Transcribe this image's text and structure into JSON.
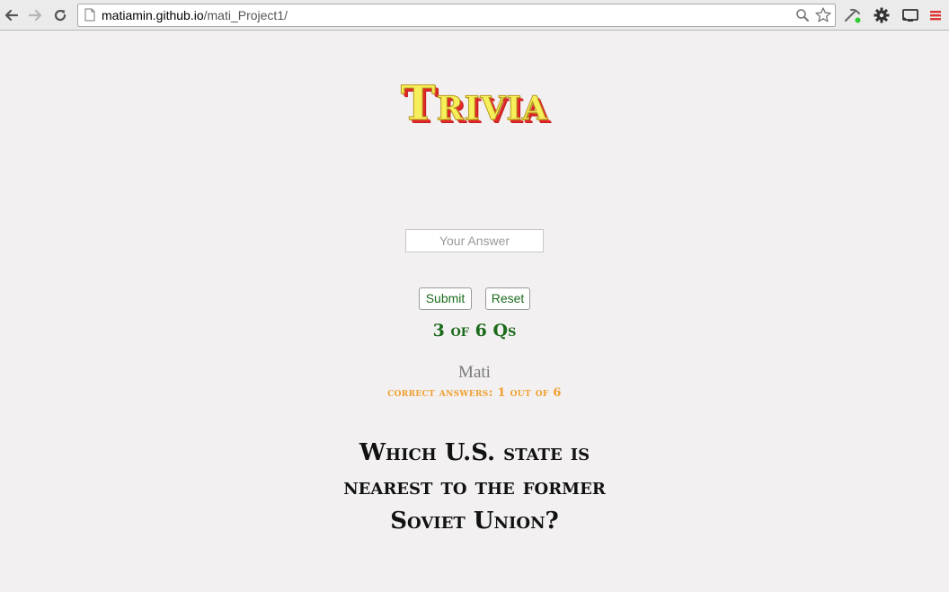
{
  "browser": {
    "url_host": "matiamin.github.io",
    "url_path": "/mati_Project1/"
  },
  "page": {
    "logo_text": "Trivia",
    "answer_placeholder": "Your Answer",
    "submit_label": "Submit",
    "reset_label": "Reset",
    "progress_text": "3 of 6 Qs",
    "player_name": "Mati",
    "score_text": "correct answers: 1 out of 6",
    "question_text": "Which U.S. state is nearest to the former Soviet Union?"
  },
  "colors": {
    "background": "#f2f0f0",
    "logo_fill": "#f6ee5a",
    "logo_shadow": "#e02828",
    "progress": "#1b6b1b",
    "score": "#f0a030",
    "player": "#7a7a7a"
  }
}
